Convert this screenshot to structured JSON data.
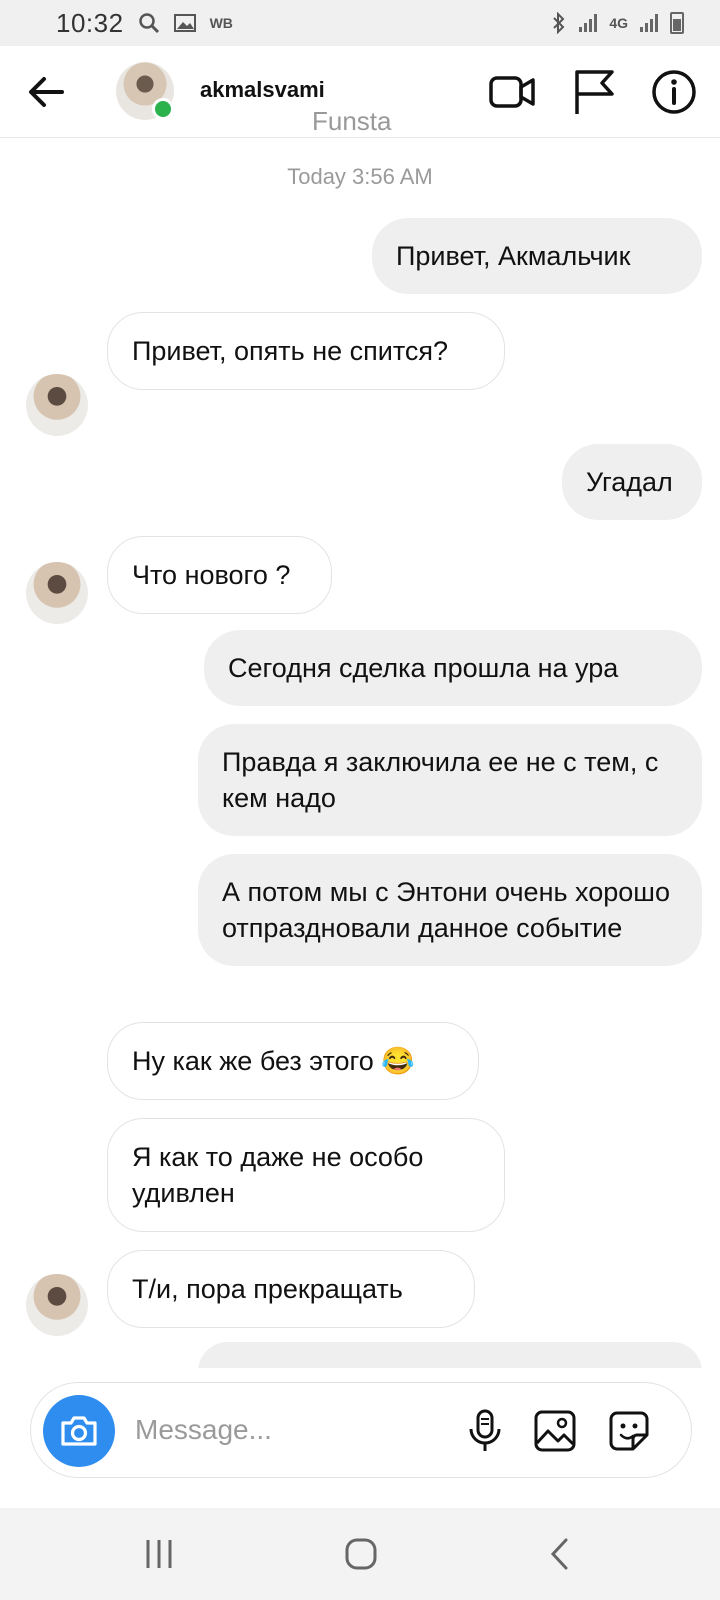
{
  "status_bar": {
    "time": "10:32",
    "carrier_badge": "WB",
    "network": "4G",
    "icons": [
      "search-icon",
      "gallery-icon",
      "bluetooth-icon",
      "signal-icon",
      "battery-icon"
    ]
  },
  "header": {
    "username": "akmalsvami",
    "subtitle": "Funsta",
    "online": true,
    "online_color": "#2bb24c",
    "actions": [
      "video-call-icon",
      "flag-icon",
      "info-icon"
    ]
  },
  "chat": {
    "timestamp": "Today 3:56 AM",
    "messages": [
      {
        "side": "out",
        "text": "Привет, Акмальчик"
      },
      {
        "side": "in",
        "text": "Привет, опять не спится?"
      },
      {
        "side": "out",
        "text": "Угадал"
      },
      {
        "side": "in",
        "text": "Что нового ?"
      },
      {
        "side": "out",
        "text": "Сегодня сделка прошла на ура"
      },
      {
        "side": "out",
        "text": "Правда я заключила ее не с тем, с кем надо"
      },
      {
        "side": "out",
        "text": "А потом мы с Энтони очень хорошо отпраздновали данное событие"
      },
      {
        "side": "in",
        "text": "Ну как же без этого 😂"
      },
      {
        "side": "in",
        "text": "Я как то даже не особо удивлен"
      },
      {
        "side": "in",
        "text": "Т/и, пора прекращать"
      }
    ]
  },
  "composer": {
    "placeholder": "Message...",
    "accent": "#2f8df0",
    "icons": [
      "camera-icon",
      "microphone-icon",
      "image-icon",
      "sticker-icon"
    ]
  },
  "navigation": {
    "buttons": [
      "recent-apps-icon",
      "home-icon",
      "back-nav-icon"
    ]
  }
}
